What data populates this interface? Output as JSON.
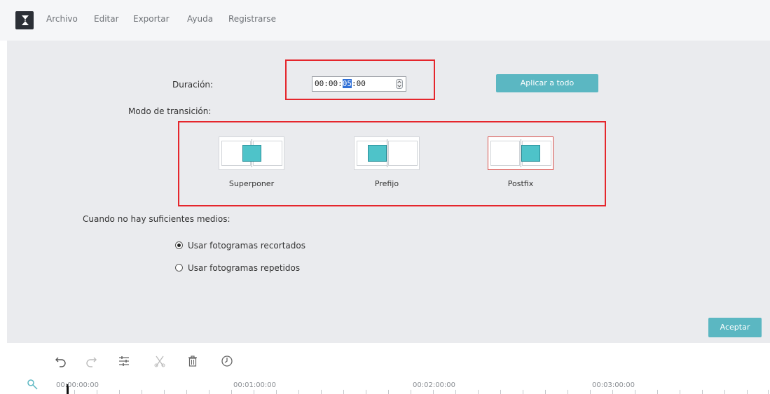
{
  "menubar": {
    "items": [
      "Archivo",
      "Editar",
      "Exportar",
      "Ayuda",
      "Registrarse"
    ]
  },
  "dialog": {
    "duration_label": "Duración:",
    "duration_value_before": "00:00:",
    "duration_value_selected": "05",
    "duration_value_after": ":00",
    "apply_all_label": "Aplicar a todo",
    "transition_mode_label": "Modo de transición:",
    "modes": [
      {
        "label": "Superponer",
        "selected": false
      },
      {
        "label": "Prefijo",
        "selected": false
      },
      {
        "label": "Postfix",
        "selected": true
      }
    ],
    "insufficient_label": "Cuando no hay suficientes medios:",
    "options": [
      {
        "label": "Usar fotogramas recortados",
        "checked": true
      },
      {
        "label": "Usar fotogramas repetidos",
        "checked": false
      }
    ],
    "accept_label": "Aceptar"
  },
  "toolbar": {
    "icons": [
      "undo-icon",
      "redo-icon",
      "adjust-icon",
      "cut-icon",
      "delete-icon",
      "speed-icon"
    ]
  },
  "timeline": {
    "timecodes": [
      "00:00:00:00",
      "00:01:00:00",
      "00:02:00:00",
      "00:03:00:00"
    ]
  },
  "colors": {
    "accent": "#5bb7c2",
    "highlight_box": "#e5262c",
    "panel_bg": "#eaebee"
  }
}
